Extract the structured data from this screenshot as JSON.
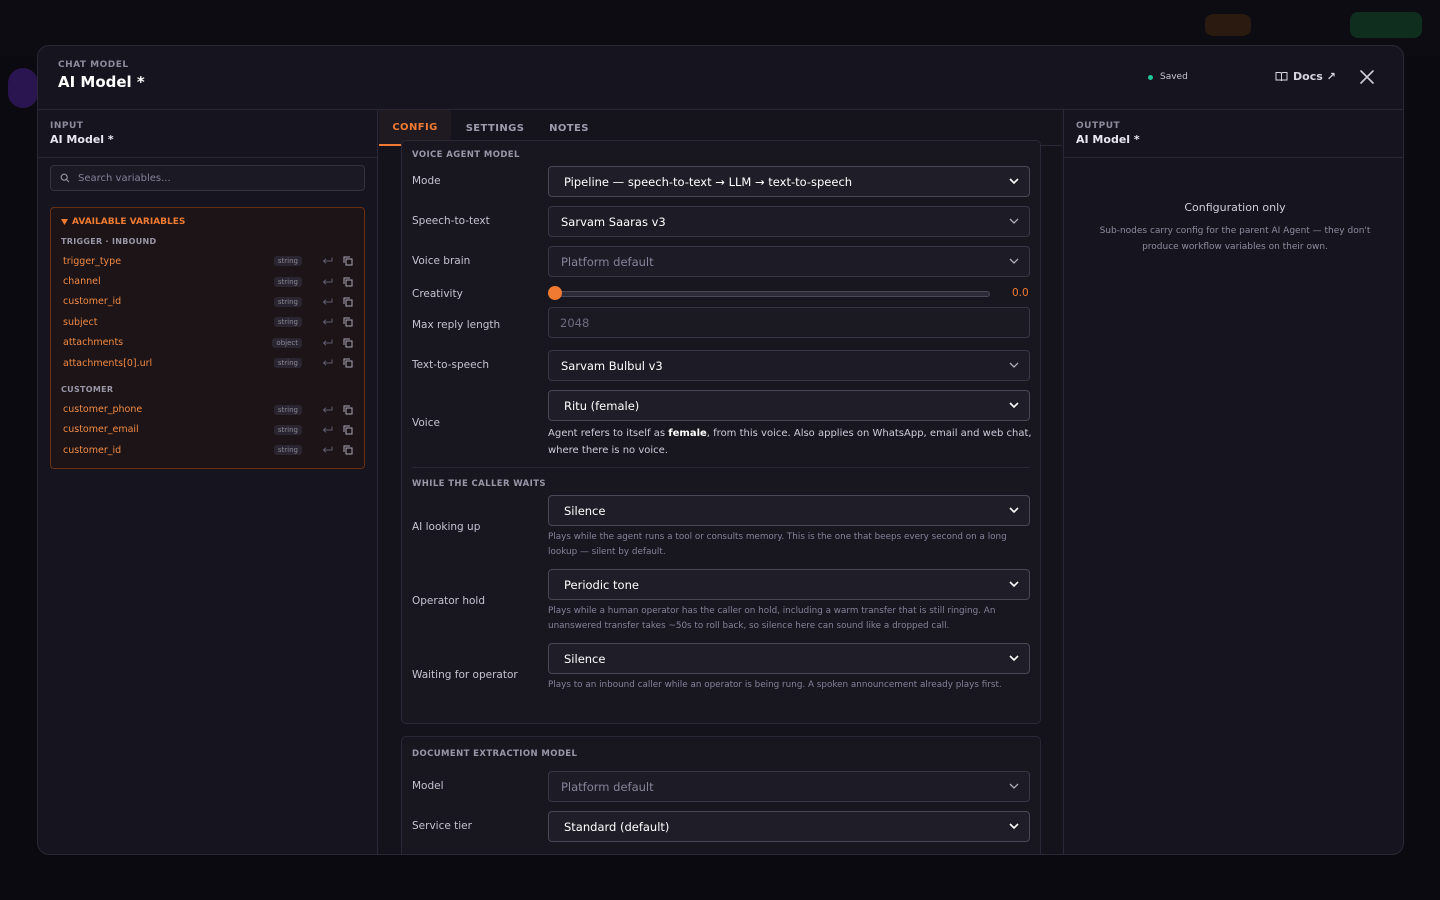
{
  "header": {
    "overline": "CHAT MODEL",
    "title": "AI Model *",
    "saved": "Saved",
    "docs": "Docs ↗"
  },
  "input_panel": {
    "overline": "INPUT",
    "title": "AI Model *",
    "search_placeholder": "Search variables...",
    "vars_title": "AVAILABLE VARIABLES",
    "groups": [
      {
        "title": "TRIGGER · INBOUND",
        "items": [
          {
            "name": "trigger_type",
            "type": "string"
          },
          {
            "name": "channel",
            "type": "string"
          },
          {
            "name": "customer_id",
            "type": "string"
          },
          {
            "name": "subject",
            "type": "string"
          },
          {
            "name": "attachments",
            "type": "object"
          },
          {
            "name": "attachments[0].url",
            "type": "string"
          }
        ]
      },
      {
        "title": "CUSTOMER",
        "items": [
          {
            "name": "customer_phone",
            "type": "string"
          },
          {
            "name": "customer_email",
            "type": "string"
          },
          {
            "name": "customer_id",
            "type": "string"
          }
        ]
      }
    ]
  },
  "tabs": [
    "CONFIG",
    "SETTINGS",
    "NOTES"
  ],
  "voice": {
    "title": "VOICE AGENT MODEL",
    "mode_label": "Mode",
    "mode_value": "Pipeline — speech-to-text → LLM → text-to-speech",
    "stt_label": "Speech-to-text",
    "stt_value": "Sarvam Saaras v3",
    "brain_label": "Voice brain",
    "brain_value": "Platform default",
    "creativity_label": "Creativity",
    "creativity_value": "0.0",
    "creativity_level": 0.0,
    "maxlen_label": "Max reply length",
    "maxlen_placeholder": "2048",
    "tts_label": "Text-to-speech",
    "tts_value": "Sarvam Bulbul v3",
    "voice_label": "Voice",
    "voice_value": "Ritu (female)",
    "voice_hint_pre": "Agent refers to itself as ",
    "voice_hint_bold": "female",
    "voice_hint_post": ", from this voice. Also applies on WhatsApp, email and web chat, where there is no voice."
  },
  "wait": {
    "title": "WHILE THE CALLER WAITS",
    "lookup_label": "AI looking up",
    "lookup_value": "Silence",
    "lookup_hint": "Plays while the agent runs a tool or consults memory. This is the one that beeps every second on a long lookup — silent by default.",
    "hold_label": "Operator hold",
    "hold_value": "Periodic tone",
    "hold_hint": "Plays while a human operator has the caller on hold, including a warm transfer that is still ringing. An unanswered transfer takes ~50s to roll back, so silence here can sound like a dropped call.",
    "waiting_label": "Waiting for operator",
    "waiting_value": "Silence",
    "waiting_hint": "Plays to an inbound caller while an operator is being rung. A spoken announcement already plays first."
  },
  "doc": {
    "title": "DOCUMENT EXTRACTION MODEL",
    "model_label": "Model",
    "model_value": "Platform default",
    "tier_label": "Service tier",
    "tier_value": "Standard (default)"
  },
  "output_panel": {
    "overline": "OUTPUT",
    "title": "AI Model *",
    "cfg_title": "Configuration only",
    "cfg_desc": "Sub-nodes carry config for the parent AI Agent — they don't produce workflow variables on their own."
  },
  "colors": {
    "accent": "#f07a31",
    "saved_dot": "#22c59a",
    "bg": "#16151f"
  }
}
